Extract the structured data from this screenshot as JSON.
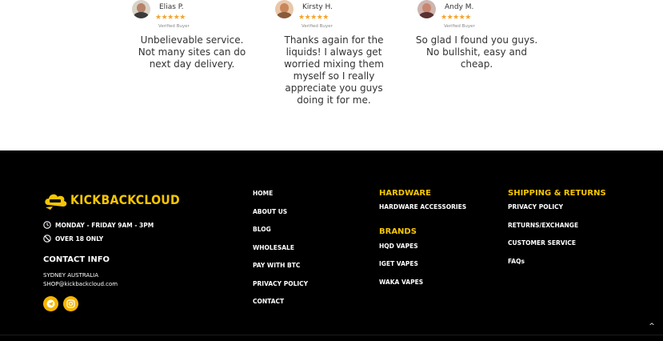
{
  "reviews": [
    {
      "name": "Elias P.",
      "stars": "★★★★★",
      "verified": "Verified Buyer",
      "text": "Unbelievable service. Not many sites can do next day delivery."
    },
    {
      "name": "Kirsty H.",
      "stars": "★★★★★",
      "verified": "Verified Buyer",
      "text": "Thanks again for the liquids! I always get worried mixing them myself so I really appreciate you guys doing it for me."
    },
    {
      "name": "Andy M.",
      "stars": "★★★★★",
      "verified": "Verified Buyer",
      "text": "So glad I found you guys. No bullshit, easy and cheap."
    }
  ],
  "footer": {
    "brand": "KICKBACKCLOUD",
    "hours": "MONDAY - FRIDAY 9AM - 3PM",
    "age": "OVER 18 ONLY",
    "contact_title": "CONTACT INFO",
    "location": "SYDNEY AUSTRALIA",
    "email": "SHOP@kickbackcloud.com",
    "social_icons": [
      "telegram-icon",
      "instagram-icon"
    ],
    "nav_links": [
      "HOME",
      "ABOUT US",
      "BLOG",
      "WHOLESALE",
      "PAY WITH BTC",
      "PRIVACY POLICY",
      "CONTACT"
    ],
    "hardware": {
      "title": "HARDWARE",
      "links": [
        "HARDWARE ACCESSORIES"
      ]
    },
    "brands": {
      "title": "BRANDS",
      "links": [
        "HQD VAPES",
        "IGET VAPES",
        "WAKA VAPES"
      ]
    },
    "shipping": {
      "title": "SHIPPING & RETURNS",
      "links": [
        "PRIVACY POLICY",
        "RETURNS/EXCHANGE",
        "CUSTOMER SERVICE",
        "FAQs"
      ]
    },
    "scroll_top": "^"
  },
  "colors": {
    "accent": "#f7c600",
    "star": "#f5a32b",
    "footer_bg": "#000000"
  }
}
